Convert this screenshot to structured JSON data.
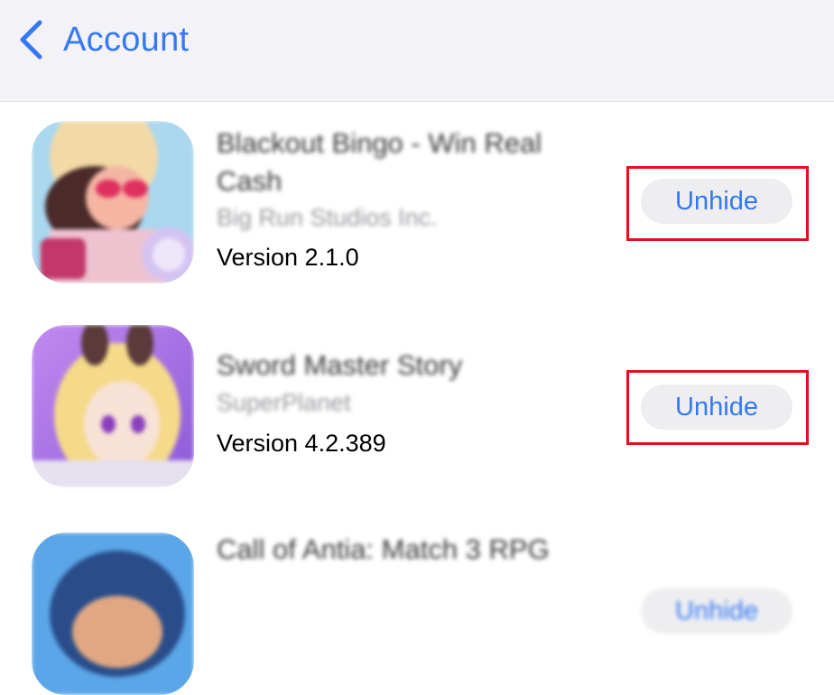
{
  "nav": {
    "back_label": "Account"
  },
  "apps": [
    {
      "name": "Blackout Bingo - Win Real Cash",
      "developer": "Big Run Studios Inc.",
      "version": "Version 2.1.0",
      "action": "Unhide"
    },
    {
      "name": "Sword Master Story",
      "developer": "SuperPlanet",
      "version": "Version 4.2.389",
      "action": "Unhide"
    },
    {
      "name": "Call of Antia: Match 3 RPG",
      "developer": "",
      "version": "",
      "action": "Unhide"
    }
  ],
  "colors": {
    "accent": "#3478f6",
    "highlight": "#e4101c",
    "navbar_bg": "#f2f2f7"
  }
}
